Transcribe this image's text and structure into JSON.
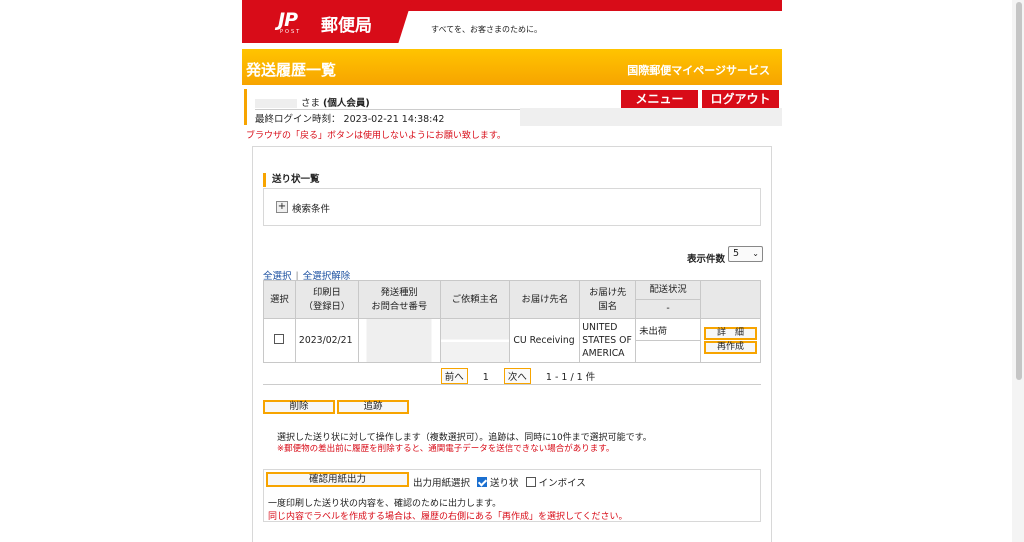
{
  "header": {
    "logo_mark": "JP",
    "logo_sub": "POST",
    "logo_name": "郵便局",
    "tagline": "すべてを、お客さまのために。"
  },
  "titlebar": {
    "title": "発送履歴一覧",
    "service": "国際郵便マイページサービス"
  },
  "user": {
    "honorific": "さま",
    "member_type": "(個人会員)",
    "last_login_label": "最終ログイン時刻：",
    "last_login": "2023-02-21 14:38:42"
  },
  "buttons": {
    "menu": "メニュー",
    "logout": "ログアウト"
  },
  "warning": "ブラウザの「戻る」ボタンは使用しないようにお願い致します。",
  "list": {
    "heading": "送り状一覧",
    "search_toggle": "+",
    "search_label": "検索条件",
    "per_page_label": "表示件数",
    "per_page_value": "5",
    "select_all": "全選択",
    "separator": "|",
    "deselect_all": "全選択解除",
    "columns": {
      "select": "選択",
      "print_date_1": "印刷日",
      "print_date_2": "（登録日）",
      "ship_type_1": "発送種別",
      "ship_type_2": "お問合せ番号",
      "sender": "ご依頼主名",
      "recipient": "お届け先名",
      "dest_1": "お届け先",
      "dest_2": "国名",
      "status": "配送状況",
      "status_sub": "-"
    },
    "rows": [
      {
        "date": "2023/02/21",
        "recipient": "CU Receiving",
        "country": "UNITED STATES OF AMERICA",
        "status": "未出荷",
        "detail_btn": "詳　細",
        "recreate_btn": "再作成"
      }
    ],
    "pager": {
      "prev": "前へ",
      "page": "1",
      "next": "次へ",
      "range": "1 - 1 / 1 件"
    }
  },
  "actions": {
    "delete": "削除",
    "track": "追跡",
    "note": "選択した送り状に対して操作します（複数選択可）。追跡は、同時に10件まで選択可能です。",
    "note_warning": "※郵便物の差出前に履歴を削除すると、通関電子データを送信できない場合があります。"
  },
  "print": {
    "button": "確認用紙出力",
    "paper_label": "出力用紙選択",
    "option_waybill": "送り状",
    "option_invoice": "インボイス",
    "waybill_checked": true,
    "invoice_checked": false,
    "note": "一度印刷した送り状の内容を、確認のために出力します。",
    "note_warning": "同じ内容でラベルを作成する場合は、履歴の右側にある「再作成」を選択してください。"
  },
  "colors": {
    "brand_red": "#d80c18",
    "accent_orange": "#f7a400",
    "link_blue": "#1a4fa0"
  }
}
